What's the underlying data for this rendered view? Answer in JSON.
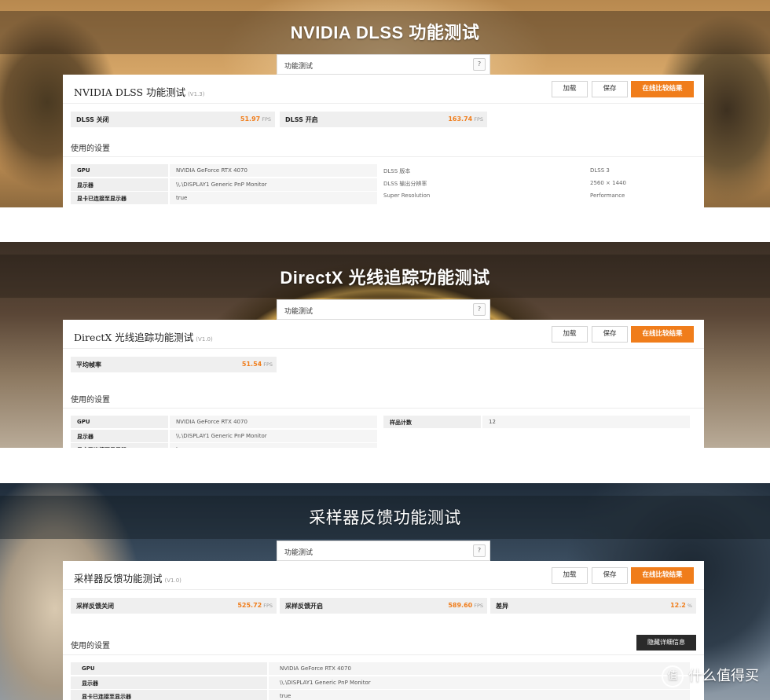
{
  "panels": [
    {
      "header_title": "NVIDIA DLSS 功能测试",
      "tab_label": "功能测试",
      "help": "?",
      "card_title": "NVIDIA DLSS 功能测试",
      "version": "(V1.3)",
      "buttons": {
        "load": "加载",
        "save": "保存",
        "online": "在线比较结果"
      },
      "scores": [
        {
          "label": "DLSS 关闭",
          "value": "51.97",
          "unit": "FPS"
        },
        {
          "label": "DLSS 开启",
          "value": "163.74",
          "unit": "FPS"
        }
      ],
      "section": "使用的设置",
      "settings": [
        {
          "key": "GPU",
          "value": "NVIDIA GeForce RTX 4070"
        },
        {
          "key": "显示器",
          "value": "\\\\.\\DISPLAY1 Generic PnP Monitor"
        },
        {
          "key": "显卡已连接至显示器",
          "value": "true"
        }
      ],
      "right_settings": [
        {
          "key": "DLSS 版本",
          "value": "DLSS 3"
        },
        {
          "key": "DLSS 输出分辨率",
          "value": "2560 × 1440"
        },
        {
          "key": "Super Resolution",
          "value": "Performance"
        }
      ]
    },
    {
      "header_title": "DirectX 光线追踪功能测试",
      "tab_label": "功能测试",
      "help": "?",
      "card_title": "DirectX 光线追踪功能测试",
      "version": "(V1.0)",
      "buttons": {
        "load": "加载",
        "save": "保存",
        "online": "在线比较结果"
      },
      "scores": [
        {
          "label": "平均帧率",
          "value": "51.54",
          "unit": "FPS"
        }
      ],
      "section": "使用的设置",
      "settings": [
        {
          "key": "GPU",
          "value": "NVIDIA GeForce RTX 4070"
        },
        {
          "key": "显示器",
          "value": "\\\\.\\DISPLAY1 Generic PnP Monitor"
        },
        {
          "key": "显卡已连接至显示器",
          "value": "true"
        }
      ],
      "right_settings": [
        {
          "key": "样品计数",
          "value": "12"
        }
      ]
    },
    {
      "header_title": "采样器反馈功能测试",
      "tab_label": "功能测试",
      "help": "?",
      "card_title": "采样器反馈功能测试",
      "version": "(V1.0)",
      "buttons": {
        "load": "加载",
        "save": "保存",
        "online": "在线比较结果"
      },
      "scores": [
        {
          "label": "采样反馈关闭",
          "value": "525.72",
          "unit": "FPS"
        },
        {
          "label": "采样反馈开启",
          "value": "589.60",
          "unit": "FPS"
        },
        {
          "label": "差异",
          "value": "12.2",
          "unit": "%"
        }
      ],
      "section": "使用的设置",
      "hide_details": "隐藏详细信息",
      "settings": [
        {
          "key": "GPU",
          "value": "NVIDIA GeForce RTX 4070"
        },
        {
          "key": "显示器",
          "value": "\\\\.\\DISPLAY1 Generic PnP Monitor"
        },
        {
          "key": "显卡已连接至显示器",
          "value": "true"
        }
      ]
    }
  ],
  "watermark": {
    "icon": "值",
    "text": "什么值得买"
  },
  "colors": {
    "accent": "#f07d1b",
    "card": "#ffffff",
    "row": "#efefef"
  }
}
